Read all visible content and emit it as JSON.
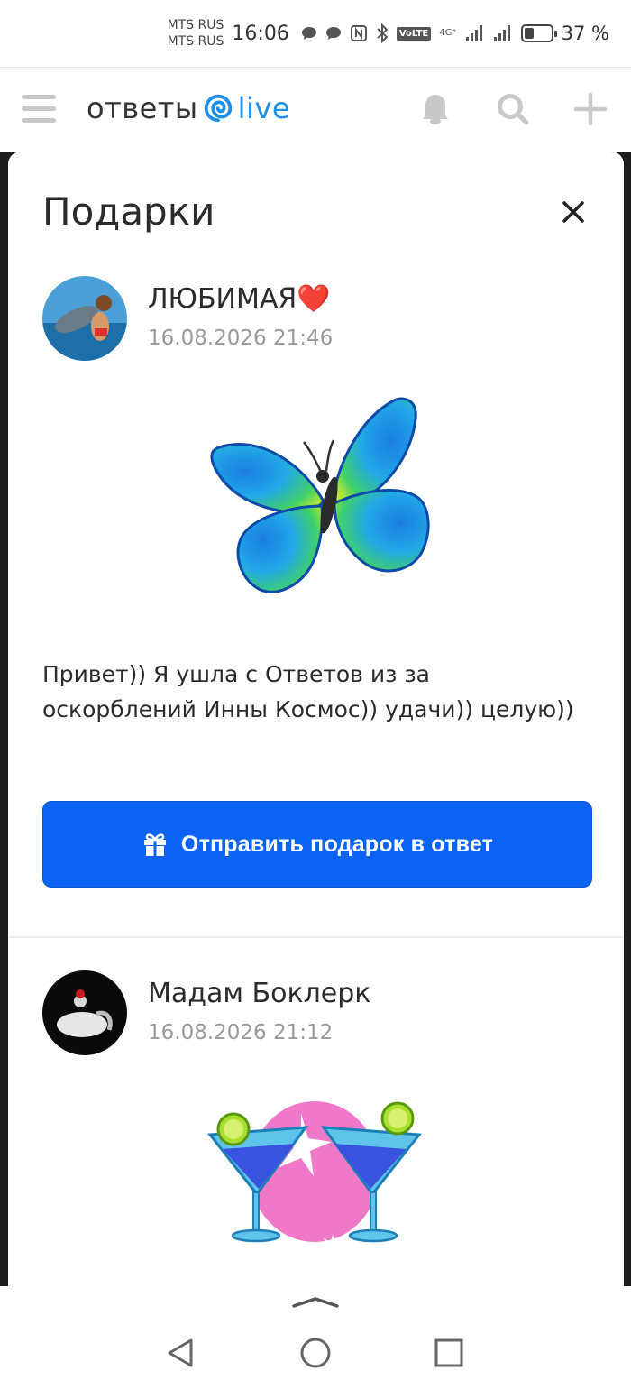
{
  "status_bar": {
    "carrier1": "MTS RUS",
    "carrier2": "MTS RUS",
    "time": "16:06",
    "volte": "VoLTE",
    "network": "4G⁺",
    "battery_level": 0.37,
    "battery_text": "37 %",
    "icons": [
      "message-bubble-icon",
      "message-bubble-icon",
      "nfc-icon",
      "bluetooth-icon",
      "signal-icon",
      "signal-icon"
    ]
  },
  "header": {
    "logo_main": "ответы",
    "logo_live": "live",
    "brand_color": "#1d8fe8",
    "icons": [
      "menu-icon",
      "bell-icon",
      "search-icon",
      "plus-icon"
    ]
  },
  "modal": {
    "title": "Подарки",
    "close_icon": "close-icon"
  },
  "gifts": [
    {
      "author": "ЛЮБИМАЯ❤️",
      "date": "16.08.2026 21:46",
      "gift": "butterfly",
      "message": "Привет)) Я ушла с Ответов из за оскорблений Инны Космос)) удачи)) целую))",
      "reply_label": "Отправить подарок в ответ",
      "reply_color": "#0a63f2"
    },
    {
      "author": "Мадам Боклерк",
      "date": "16.08.2026 21:12",
      "gift": "cocktails"
    }
  ],
  "nav": {
    "icons": [
      "chevron-up-icon",
      "back-icon",
      "home-icon",
      "recent-apps-icon"
    ]
  }
}
